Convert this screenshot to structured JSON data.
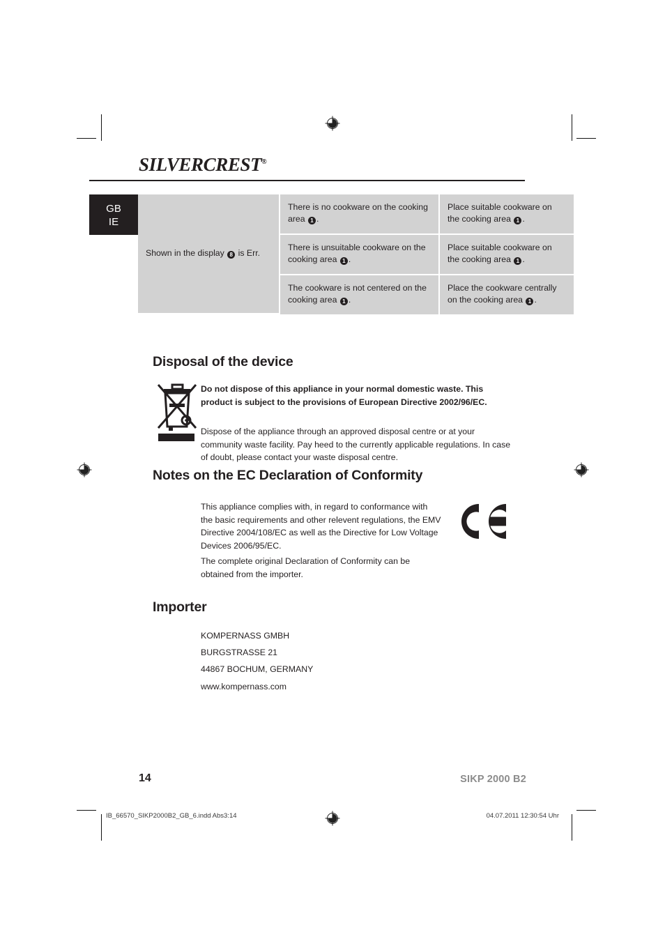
{
  "brand": {
    "logo_primary": "SILVER",
    "logo_secondary": "CREST",
    "registered_mark": "®"
  },
  "language_tab": {
    "line1": "GB",
    "line2": "IE"
  },
  "troubleshooting_table": {
    "problem": "Shown in the display ❽ is Err.",
    "problem_prefix": "Shown in the display ",
    "problem_marker": "8",
    "problem_suffix": " is Err.",
    "rows": [
      {
        "cause_prefix": "There is no cookware on the cooking area ",
        "cause_marker": "1",
        "cause_suffix": ".",
        "remedy_prefix": "Place suitable cookware on the cooking area ",
        "remedy_marker": "1",
        "remedy_suffix": "."
      },
      {
        "cause_prefix": "There is unsuitable cookware on the cooking area ",
        "cause_marker": "1",
        "cause_suffix": ".",
        "remedy_prefix": "Place suitable cookware on the cooking area ",
        "remedy_marker": "1",
        "remedy_suffix": "."
      },
      {
        "cause_prefix": "The cookware is not centered on the cooking area ",
        "cause_marker": "1",
        "cause_suffix": ".",
        "remedy_prefix": "Place the cookware centrally on the cooking area ",
        "remedy_marker": "1",
        "remedy_suffix": "."
      }
    ]
  },
  "disposal": {
    "heading": "Disposal of the device",
    "bold_note": "Do not dispose of this appliance in your normal domestic waste. This product is subject to the provisions of European Directive 2002/96/EC.",
    "paragraph": "Dispose of the appliance through an approved disposal centre or at your community waste facility. Pay heed to the currently applicable regulations. In case of doubt, please contact your waste disposal centre.",
    "icon": "weee-crossed-bin-icon"
  },
  "conformity": {
    "heading": "Notes on the EC Declaration of Conformity",
    "paragraph1": "This appliance complies with, in regard to conformance with the basic requirements and other relevent regulations, the EMV Directive 2004/108/EC as well as the Directive for Low Voltage Devices 2006/95/EC.",
    "paragraph2": "The complete original Declaration of Conformity can be obtained from the importer.",
    "mark": "CE"
  },
  "importer": {
    "heading": "Importer",
    "lines": [
      "KOMPERNASS GMBH",
      "BURGSTRASSE 21",
      "44867 BOCHUM, GERMANY",
      "www.kompernass.com"
    ]
  },
  "footer": {
    "page_number": "14",
    "model": "SIKP 2000 B2",
    "slug_left": "IB_66570_SIKP2000B2_GB_6.indd   Abs3:14",
    "slug_right": "04.07.2011   12:30:54 Uhr"
  },
  "colors": {
    "ink": "#231f20",
    "table_fill": "#d2d2d2",
    "model_gray": "#8c8c8c",
    "paper": "#ffffff"
  }
}
